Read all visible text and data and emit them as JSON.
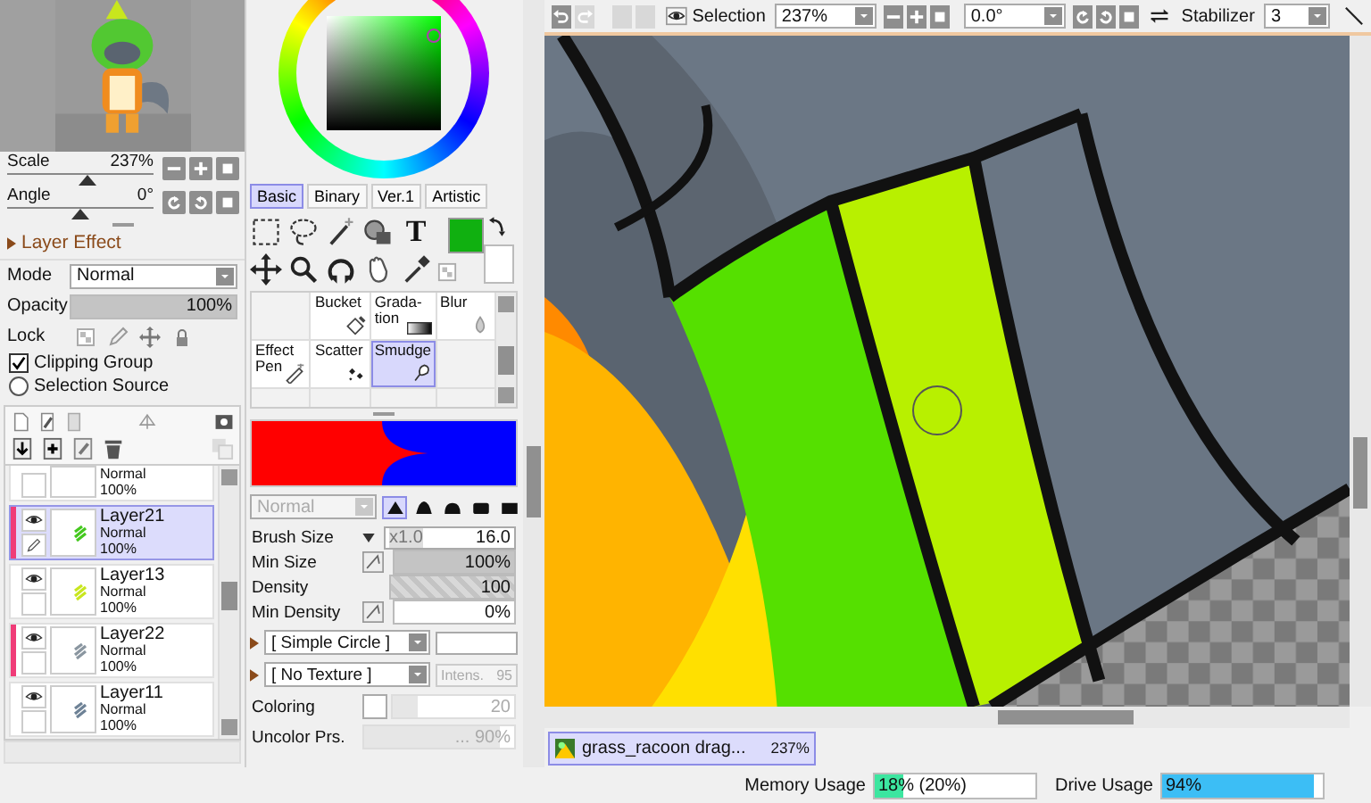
{
  "navigator": {
    "scale": {
      "label": "Scale",
      "value": "237%",
      "level": 0.55
    },
    "angle": {
      "label": "Angle",
      "value": "0°",
      "level": 0.5
    }
  },
  "layer_panel": {
    "section": "Layer Effect",
    "mode": {
      "label": "Mode",
      "value": "Normal"
    },
    "opacity": {
      "label": "Opacity",
      "value": "100%",
      "level": 1
    },
    "lock_label": "Lock",
    "options": [
      {
        "kind": "checkbox",
        "label": "Clipping Group",
        "checked": true
      },
      {
        "kind": "radio",
        "label": "Selection Source",
        "checked": false
      }
    ],
    "layers": [
      {
        "mode": "Normal",
        "opacity": "100%",
        "selected": false,
        "tagged": false,
        "editing": false
      },
      {
        "name": "Layer21",
        "mode": "Normal",
        "opacity": "100%",
        "selected": true,
        "tagged": true,
        "editing": true,
        "color": "#44c81e"
      },
      {
        "name": "Layer13",
        "mode": "Normal",
        "opacity": "100%",
        "selected": false,
        "tagged": false,
        "editing": false,
        "color": "#c8e61e"
      },
      {
        "name": "Layer22",
        "mode": "Normal",
        "opacity": "100%",
        "selected": false,
        "tagged": true,
        "editing": false,
        "color": "#8a96a0"
      },
      {
        "name": "Layer11",
        "mode": "Normal",
        "opacity": "100%",
        "selected": false,
        "tagged": false,
        "editing": false,
        "color": "#6e8296"
      }
    ]
  },
  "color_panel": {
    "tabs": [
      {
        "label": "Basic",
        "selected": true
      },
      {
        "label": "Binary",
        "selected": false
      },
      {
        "label": "Ver.1",
        "selected": false
      },
      {
        "label": "Artistic",
        "selected": false
      }
    ],
    "text_tool": "T"
  },
  "brushes": [
    {
      "kind": "empty",
      "selected": false
    },
    {
      "kind": "bucket",
      "label": "Bucket",
      "selected": false
    },
    {
      "kind": "gradation",
      "label": "Grada-\ntion",
      "selected": false
    },
    {
      "kind": "blur",
      "label": "Blur",
      "selected": false
    },
    {
      "kind": "pen",
      "label": "Effect\nPen",
      "selected": false
    },
    {
      "kind": "scatter",
      "label": "Scatter",
      "selected": false
    },
    {
      "kind": "smudge",
      "label": "Smudge",
      "selected": true
    },
    {
      "kind": "empty",
      "selected": false
    }
  ],
  "brush_settings": {
    "blend": {
      "value": "Normal",
      "disabled": true
    },
    "tip_shapes": [
      {
        "selected": true
      },
      {
        "selected": false
      },
      {
        "selected": false
      },
      {
        "selected": false
      },
      {
        "selected": false
      }
    ],
    "params": [
      {
        "kind": "size",
        "label": "Brush Size",
        "multiplier": "x1.0",
        "value": "16.0"
      },
      {
        "kind": "pressure",
        "label": "Min Size",
        "value": "100%",
        "level": 1
      },
      {
        "kind": "density",
        "label": "Density",
        "value": "100",
        "level": 1
      },
      {
        "kind": "pressure",
        "label": "Min Density",
        "value": "0%",
        "level": 0
      }
    ],
    "shape": {
      "value": "[ Simple Circle ]"
    },
    "texture": {
      "value": "[ No Texture ]",
      "intensity_label": "Intens.",
      "intensity": "95"
    },
    "coloring": {
      "label": "Coloring",
      "checked": false,
      "value": "20",
      "level": 0.2
    },
    "uncolor": {
      "label": "Uncolor Prs.",
      "value": "... 90%",
      "level": 0.9
    }
  },
  "toolbar": {
    "selection_label": "Selection",
    "zoom": "237%",
    "angle": "0.0°",
    "stabilizer_label": "Stabilizer",
    "stabilizer": "3"
  },
  "document_tab": {
    "title": "grass_racoon drag...",
    "zoom": "237%",
    "selected": true
  },
  "status_bar": {
    "memory": {
      "label": "Memory Usage",
      "value": "18%",
      "extra": "(20%)",
      "level": 0.18
    },
    "drive": {
      "label": "Drive Usage",
      "value": "94%",
      "level": 0.94
    }
  }
}
